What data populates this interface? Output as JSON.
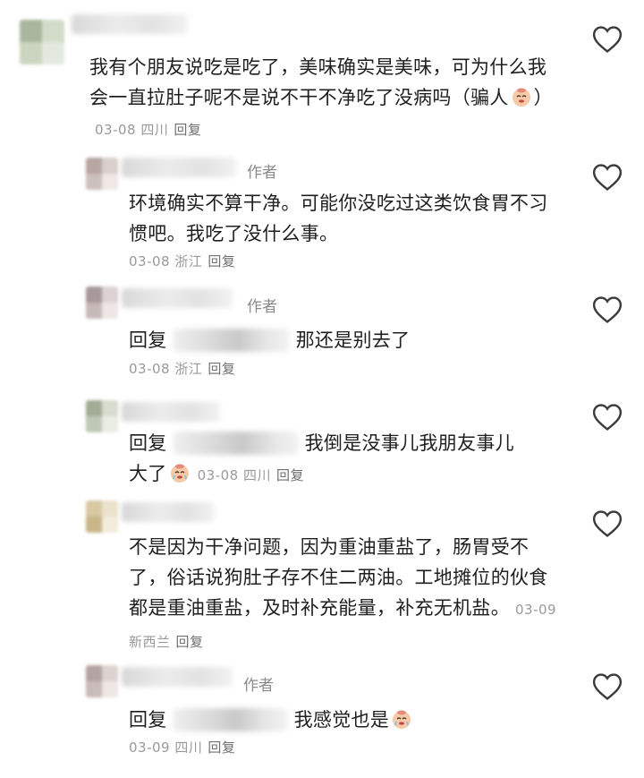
{
  "comments": [
    {
      "text": "我有个朋友说吃是吃了，美味确实是美味，可为什么我会一直拉肚子呢不是说不干不净吃了没病吗（骗人",
      "text_tail": "）",
      "date": "03-08",
      "location": "四川",
      "reply_label": "回复",
      "emoji": "crying-face"
    },
    {
      "author_tag": "作者",
      "text": "环境确实不算干净。可能你没吃过这类饮食胃不习惯吧。我吃了没什么事。",
      "date": "03-08",
      "location": "浙江",
      "reply_label": "回复"
    },
    {
      "author_tag": "作者",
      "reply_prefix": "回复",
      "text": "那还是别去了",
      "date": "03-08",
      "location": "浙江",
      "reply_label": "回复"
    },
    {
      "reply_prefix": "回复",
      "text_line1": "我倒是没事儿我朋友事儿",
      "text_line2": "大了",
      "date": "03-08",
      "location": "四川",
      "reply_label": "回复",
      "emoji": "crying-face"
    },
    {
      "text": "不是因为干净问题，因为重油重盐了，肠胃受不了，俗话说狗肚子存不住二两油。工地摊位的伙食都是重油重盐，及时补充能量，补充无机盐。",
      "date": "03-09",
      "location": "新西兰",
      "reply_label": "回复"
    },
    {
      "author_tag": "作者",
      "reply_prefix": "回复",
      "text": "我感觉也是",
      "date": "03-09",
      "location": "四川",
      "reply_label": "回复",
      "emoji": "crying-face"
    }
  ],
  "icons": {
    "like": "heart-outline-icon"
  },
  "colors": {
    "text": "#1f1f1f",
    "meta": "#9a9a9a",
    "author_tag": "#8a8a8a"
  }
}
